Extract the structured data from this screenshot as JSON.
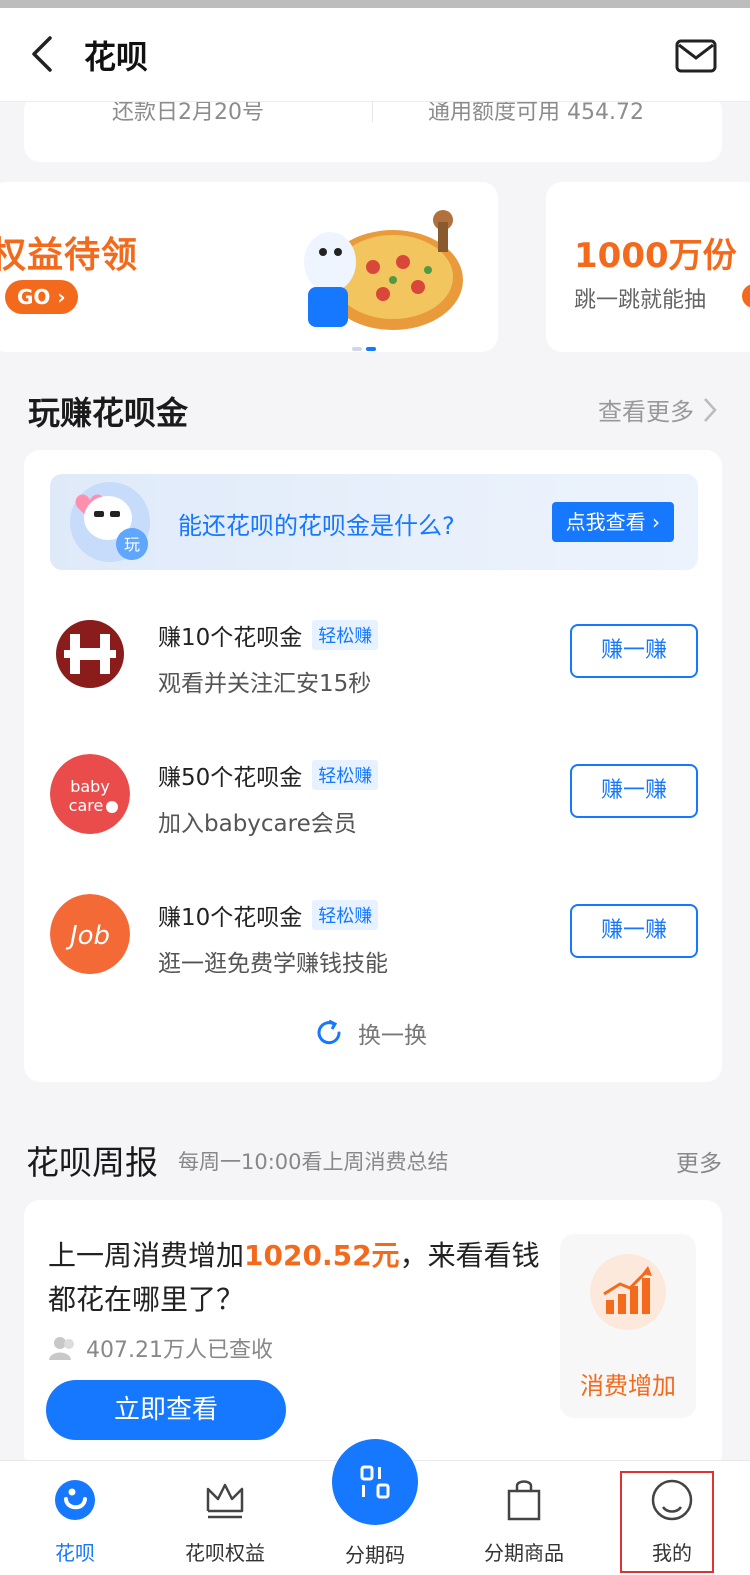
{
  "header": {
    "title": "花呗"
  },
  "credit": {
    "repay_date": "还款日2月20号",
    "available": "通用额度可用 454.72"
  },
  "banners": [
    {
      "title": "权益待领",
      "button": "GO",
      "cta_icon": "chevron-right-icon"
    },
    {
      "title": "1000万份",
      "subtitle": "跳一跳就能抽"
    }
  ],
  "earn": {
    "title": "玩赚花呗金",
    "more": "查看更多",
    "promo": {
      "text": "能还花呗的花呗金是什么?",
      "button": "点我查看",
      "icon_label": "玩"
    },
    "tasks": [
      {
        "title": "赚10个花呗金",
        "tag": "轻松赚",
        "subtitle": "观看并关注汇安15秒",
        "button": "赚一赚",
        "logo": "huian-logo"
      },
      {
        "title": "赚50个花呗金",
        "tag": "轻松赚",
        "subtitle": "加入babycare会员",
        "button": "赚一赚",
        "logo": "babycare-logo"
      },
      {
        "title": "赚10个花呗金",
        "tag": "轻松赚",
        "subtitle": "逛一逛免费学赚钱技能",
        "button": "赚一赚",
        "logo": "job-logo"
      }
    ],
    "refresh": "换一换"
  },
  "weekly": {
    "title": "花呗周报",
    "subtitle": "每周一10:00看上周消费总结",
    "more": "更多",
    "line_prefix": "上一周消费增加",
    "amount": "1020.52元",
    "line_suffix": "，来看看钱都花在哪里了？",
    "viewers": "407.21万人已查收",
    "button": "立即查看",
    "trend_label": "消费增加"
  },
  "tabs": [
    {
      "label": "花呗",
      "icon": "huabei-icon",
      "active": true
    },
    {
      "label": "花呗权益",
      "icon": "crown-icon"
    },
    {
      "label": "分期码",
      "icon": "scan-code-icon"
    },
    {
      "label": "分期商品",
      "icon": "shopping-bag-icon"
    },
    {
      "label": "我的",
      "icon": "profile-icon"
    }
  ],
  "colors": {
    "accent": "#1677ff",
    "orange": "#f36a1d",
    "background": "#f5f5f7"
  }
}
